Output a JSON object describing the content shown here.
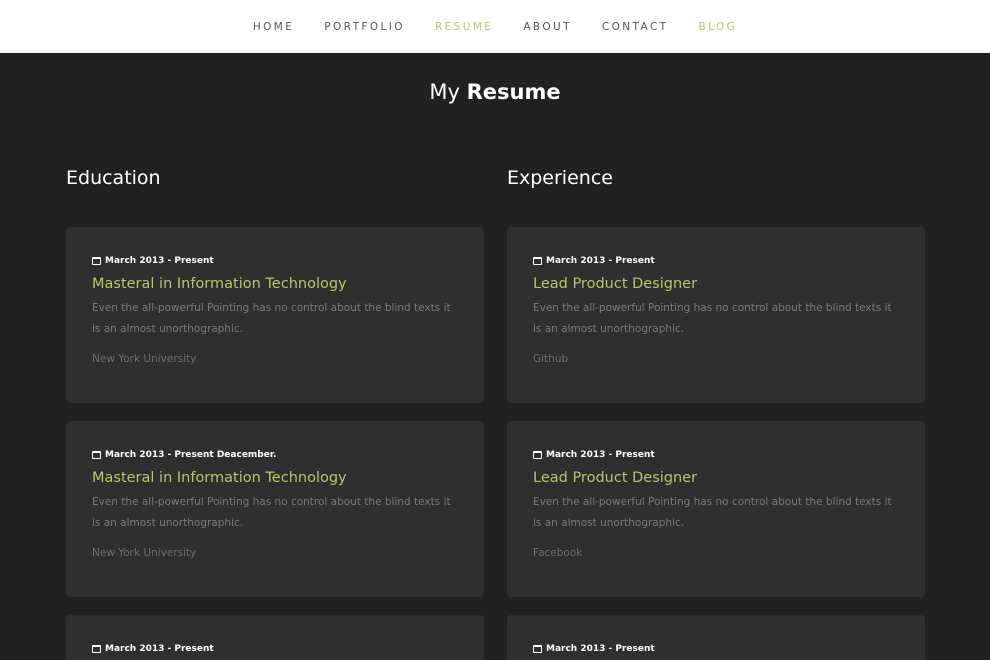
{
  "nav": {
    "items": [
      {
        "label": "HOME",
        "accent": false
      },
      {
        "label": "PORTFOLIO",
        "accent": false
      },
      {
        "label": "RESUME",
        "accent": true
      },
      {
        "label": "ABOUT",
        "accent": false
      },
      {
        "label": "CONTACT",
        "accent": false
      },
      {
        "label": "BLOG",
        "accent": true
      }
    ]
  },
  "page_title": {
    "prefix": "My",
    "strong": "Resume"
  },
  "education": {
    "heading": "Education",
    "cards": [
      {
        "date": "March 2013 - Present",
        "title": "Masteral in Information Technology",
        "desc": "Even the all-powerful Pointing has no control about the blind texts it is an almost unorthographic.",
        "org": "New York University"
      },
      {
        "date": "March 2013 - Present Deacember.",
        "title": "Masteral in Information Technology",
        "desc": "Even the all-powerful Pointing has no control about the blind texts it is an almost unorthographic.",
        "org": "New York University"
      },
      {
        "date": "March 2013 - Present",
        "title": "",
        "desc": "",
        "org": ""
      }
    ]
  },
  "experience": {
    "heading": "Experience",
    "cards": [
      {
        "date": "March 2013 - Present",
        "title": "Lead Product Designer",
        "desc": "Even the all-powerful Pointing has no control about the blind texts it is an almost unorthographic.",
        "org": "Github"
      },
      {
        "date": "March 2013 - Present",
        "title": "Lead Product Designer",
        "desc": "Even the all-powerful Pointing has no control about the blind texts it is an almost unorthographic.",
        "org": "Facebook"
      },
      {
        "date": "March 2013 - Present",
        "title": "",
        "desc": "",
        "org": ""
      }
    ]
  },
  "colors": {
    "background": "#212121",
    "card": "#2f2f2f",
    "accent": "#b3c86a",
    "nav_bg": "#ffffff",
    "nav_text": "#555555"
  }
}
